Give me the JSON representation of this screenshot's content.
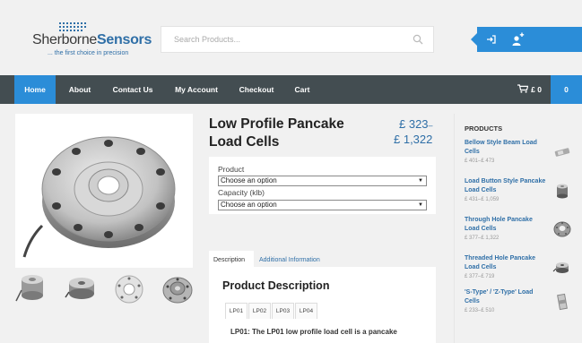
{
  "header": {
    "logo_word_a": "Sherborne",
    "logo_word_b": "Sensors",
    "logo_tagline": "... the first choice in precision",
    "search_placeholder": "Search Products...",
    "accent": "#2b8dd8",
    "login_icon": "login-arrow-icon",
    "register_icon": "user-plus-icon"
  },
  "nav": {
    "items": [
      "Home",
      "About",
      "Contact Us",
      "My Account",
      "Checkout",
      "Cart"
    ],
    "cart_total": "£ 0",
    "cart_count": "0",
    "bg": "#434d51"
  },
  "product": {
    "title": "Low Profile Pancake Load Cells",
    "price_low": "£ 323",
    "price_dash": "–",
    "price_high": "£ 1,322",
    "variations": {
      "product_label": "Product",
      "product_value": "Choose an option",
      "capacity_label": "Capacity (klb)",
      "capacity_value": "Choose an option"
    },
    "tabs": [
      "Description",
      "Additional Information"
    ],
    "description_title": "Product Description",
    "subtabs": [
      "LP01",
      "LP02",
      "LP03",
      "LP04"
    ],
    "description_text": "LP01: The LP01 low profile load cell is a pancake"
  },
  "sidebar": {
    "heading": "PRODUCTS",
    "items": [
      {
        "name": "Bellow Style Beam Load Cells",
        "price": "£ 401–£ 473"
      },
      {
        "name": "Load Button Style Pancake Load Cells",
        "price": "£ 431–£ 1,059"
      },
      {
        "name": "Through Hole Pancake Load Cells",
        "price": "£ 377–£ 1,322"
      },
      {
        "name": "Threaded Hole Pancake Load Cells",
        "price": "£ 377–£ 719"
      },
      {
        "name": "'S-Type' / 'Z-Type' Load Cells",
        "price": "£ 233–£ 510"
      }
    ]
  }
}
